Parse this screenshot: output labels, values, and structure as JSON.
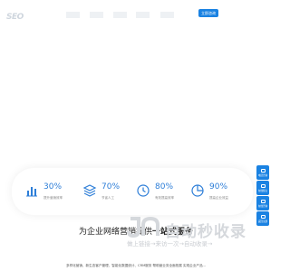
{
  "header": {
    "logo_text": "SEO",
    "cta_label": "立即咨询"
  },
  "stats": [
    {
      "value": "30%",
      "label": "提升营销效率",
      "icon": "bar-chart-icon"
    },
    {
      "value": "70%",
      "label": "节省人工",
      "icon": "layers-icon"
    },
    {
      "value": "80%",
      "label": "有效提高效率",
      "icon": "clock-icon"
    },
    {
      "value": "90%",
      "label": "提高企业效益",
      "icon": "pie-chart-icon"
    }
  ],
  "side_panel": [
    {
      "label": "电话咨询",
      "icon": "phone-icon"
    },
    {
      "label": "在线留言",
      "icon": "message-icon"
    },
    {
      "label": "在线咨询",
      "icon": "chat-icon"
    },
    {
      "label": "返回顶部",
      "icon": "top-icon"
    }
  ],
  "watermark": {
    "title": "自动秒收录",
    "subtitle": "做上链接→来访一次→自动收录→"
  },
  "section": {
    "title_prefix": "为企业网络营销提供",
    "title_strong": "一站式服务",
    "description": "多样化营销、新生态客户管理、智能化数据统计、CRM服务 帮助营业务全面拓展 实现企业产品..."
  },
  "colors": {
    "accent": "#1a82e2",
    "stat_value": "#2d7ed8"
  }
}
